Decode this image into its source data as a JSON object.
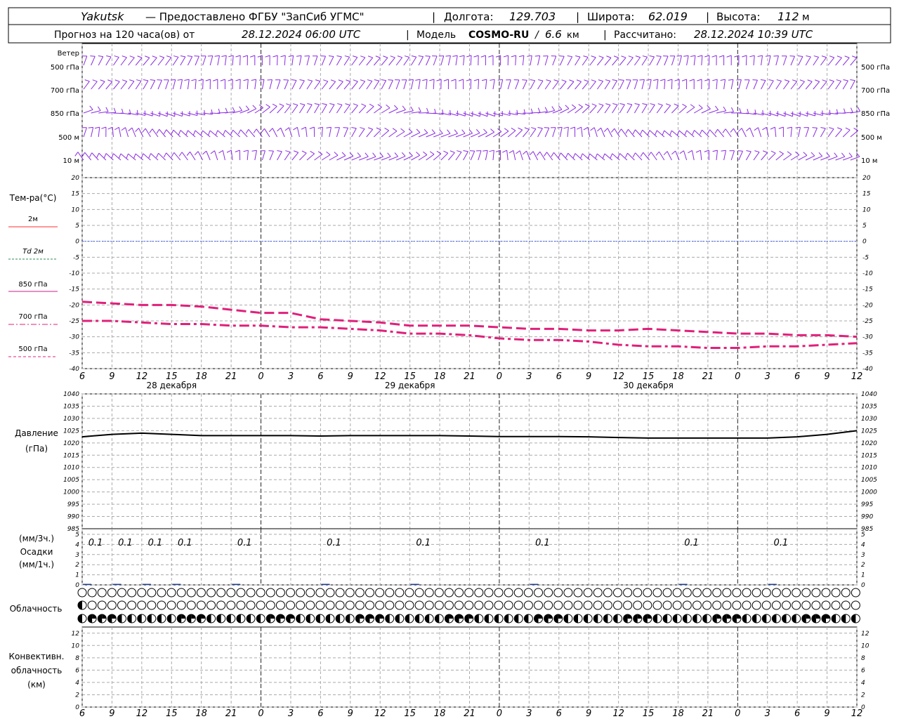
{
  "header": {
    "location": "Yakutsk",
    "provider": "— Предоставлено ФГБУ \"ЗапСиб УГМС\"",
    "lon_label": "Долгота:",
    "lon_value": "129.703",
    "lat_label": "Широта:",
    "lat_value": "62.019",
    "alt_label": "Высота:",
    "alt_value": "112",
    "alt_unit": "м",
    "forecast_prefix": "Прогноз на 120 часа(ов) от",
    "forecast_start": "28.12.2024 06:00 UTC",
    "model_label": "Модель",
    "model_name": "COSMO-RU",
    "model_res": "6.6",
    "model_res_unit": "км",
    "calc_label": "Рассчитано:",
    "calc_time": "28.12.2024 10:39 UTC"
  },
  "wind_panel": {
    "title": "Ветер",
    "levels": [
      "500 гПа",
      "700 гПа",
      "850 гПа",
      "500 м",
      "10 м"
    ],
    "barb_color": "#8a2be2"
  },
  "temp_panel": {
    "title": "Тем-ра(°С)",
    "legend": [
      {
        "label": "2м",
        "color": "#ff3030",
        "style": "solid"
      },
      {
        "label": "Td 2м",
        "color": "#2e8b57",
        "style": "dashed"
      },
      {
        "label": "850 гПа",
        "color": "#cc2288",
        "style": "solid"
      },
      {
        "label": "700 гПа",
        "color": "#e0207a",
        "style": "dashdot"
      },
      {
        "label": "500 гПа",
        "color": "#e0207a",
        "style": "dashed"
      }
    ],
    "y_ticks": [
      "20",
      "15",
      "10",
      "5",
      "0",
      "-5",
      "-10",
      "-15",
      "-20",
      "-25",
      "-30",
      "-35",
      "-40"
    ]
  },
  "x_axis": {
    "hour_labels": [
      "6",
      "9",
      "12",
      "15",
      "18",
      "21",
      "0",
      "3",
      "6",
      "9",
      "12",
      "15",
      "18",
      "21",
      "0",
      "3",
      "6",
      "9",
      "12",
      "15",
      "18",
      "21",
      "0",
      "3",
      "6",
      "9",
      "12"
    ],
    "day_labels": [
      "28 декабря",
      "29 декабря",
      "30 декабря"
    ]
  },
  "pressure_panel": {
    "title": "Давление",
    "unit": "(гПа)",
    "y_ticks": [
      "1040",
      "1035",
      "1030",
      "1025",
      "1020",
      "1015",
      "1010",
      "1005",
      "1000",
      "995",
      "990",
      "985"
    ]
  },
  "precip_panel": {
    "title1": "(мм/3ч.)",
    "title2": "Осадки",
    "title3": "(мм/1ч.)",
    "y_ticks": [
      "5",
      "4",
      "3",
      "2",
      "1",
      "0"
    ],
    "amount_labels": [
      "0.1",
      "0.1",
      "0.1",
      "0.1",
      "0.1",
      "0.1",
      "0.1",
      "0.1",
      "0.1",
      "0.1"
    ]
  },
  "cloud_panel": {
    "title": "Облачность"
  },
  "conv_panel": {
    "title1": "Конвективн.",
    "title2": "облачность",
    "title3": "(км)",
    "y_ticks": [
      "12",
      "10",
      "8",
      "6",
      "4",
      "2",
      "0"
    ]
  },
  "chart_data": [
    {
      "type": "line",
      "title": "Тем-ра(°С)",
      "x_hours": [
        0,
        3,
        6,
        9,
        12,
        15,
        18,
        21,
        24,
        27,
        30,
        33,
        36,
        39,
        42,
        45,
        48,
        51,
        54,
        57,
        60,
        63,
        66,
        69,
        72,
        75,
        78
      ],
      "ylim": [
        -40,
        20
      ],
      "series": [
        {
          "name": "700 гПа",
          "style": "dashed",
          "values": [
            -19.0,
            -19.5,
            -20.0,
            -20.0,
            -20.5,
            -21.5,
            -22.5,
            -22.5,
            -24.5,
            -25.0,
            -25.5,
            -26.5,
            -26.5,
            -26.5,
            -27.0,
            -27.5,
            -27.5,
            -28.0,
            -28.0,
            -27.5,
            -28.0,
            -28.5,
            -29.0,
            -29.0,
            -29.5,
            -29.5,
            -30.0
          ]
        },
        {
          "name": "500 гПа",
          "style": "dashdot",
          "values": [
            -25.0,
            -25.0,
            -25.5,
            -26.0,
            -26.0,
            -26.5,
            -26.5,
            -27.0,
            -27.0,
            -27.5,
            -28.0,
            -29.0,
            -29.0,
            -29.5,
            -30.5,
            -31.0,
            -31.0,
            -31.5,
            -32.5,
            -33.0,
            -33.0,
            -33.5,
            -33.5,
            -33.0,
            -33.0,
            -32.5,
            -32.0
          ]
        },
        {
          "name": "0 line",
          "style": "dotted",
          "values": [
            0,
            0
          ]
        }
      ]
    },
    {
      "type": "line",
      "title": "Давление (гПа)",
      "x_hours": [
        0,
        3,
        6,
        9,
        12,
        15,
        18,
        21,
        24,
        27,
        30,
        33,
        36,
        39,
        42,
        45,
        48,
        51,
        54,
        57,
        60,
        63,
        66,
        69,
        72,
        75,
        78
      ],
      "ylim": [
        985,
        1040
      ],
      "values": [
        1022.5,
        1023.5,
        1024.0,
        1023.5,
        1023.0,
        1023.0,
        1023.0,
        1023.0,
        1022.8,
        1023.0,
        1023.0,
        1023.0,
        1023.0,
        1022.8,
        1022.6,
        1022.6,
        1022.6,
        1022.5,
        1022.2,
        1022.0,
        1022.0,
        1022.0,
        1022.0,
        1022.0,
        1022.5,
        1023.5,
        1025.0
      ]
    },
    {
      "type": "bar",
      "title": "Осадки",
      "ylim": [
        0,
        5
      ],
      "bars": [
        {
          "hour": 0.5,
          "value": 0.1
        },
        {
          "hour": 3.5,
          "value": 0.1
        },
        {
          "hour": 6.5,
          "value": 0.1
        },
        {
          "hour": 9.5,
          "value": 0.1
        },
        {
          "hour": 15.5,
          "value": 0.1
        },
        {
          "hour": 24.5,
          "value": 0.1
        },
        {
          "hour": 33.5,
          "value": 0.1
        },
        {
          "hour": 45.5,
          "value": 0.1
        },
        {
          "hour": 60.5,
          "value": 0.1
        },
        {
          "hour": 69.5,
          "value": 0.1
        }
      ]
    }
  ]
}
